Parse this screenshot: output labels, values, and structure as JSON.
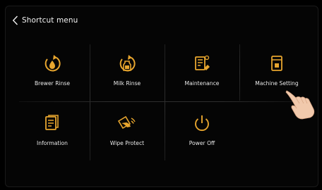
{
  "header": {
    "title": "Shortcut menu"
  },
  "menu": {
    "items": [
      {
        "label": "Brewer Rinse",
        "icon": "brewer-rinse-icon"
      },
      {
        "label": "Milk Rinse",
        "icon": "milk-rinse-icon"
      },
      {
        "label": "Maintenance",
        "icon": "maintenance-icon"
      },
      {
        "label": "Machine Setting",
        "icon": "machine-setting-icon"
      },
      {
        "label": "Information",
        "icon": "information-icon"
      },
      {
        "label": "Wipe Protect",
        "icon": "wipe-protect-icon"
      },
      {
        "label": "Power Off",
        "icon": "power-off-icon"
      }
    ]
  },
  "colors": {
    "accent": "#e7a52e",
    "background": "#050505",
    "text": "#e9e9e9"
  }
}
